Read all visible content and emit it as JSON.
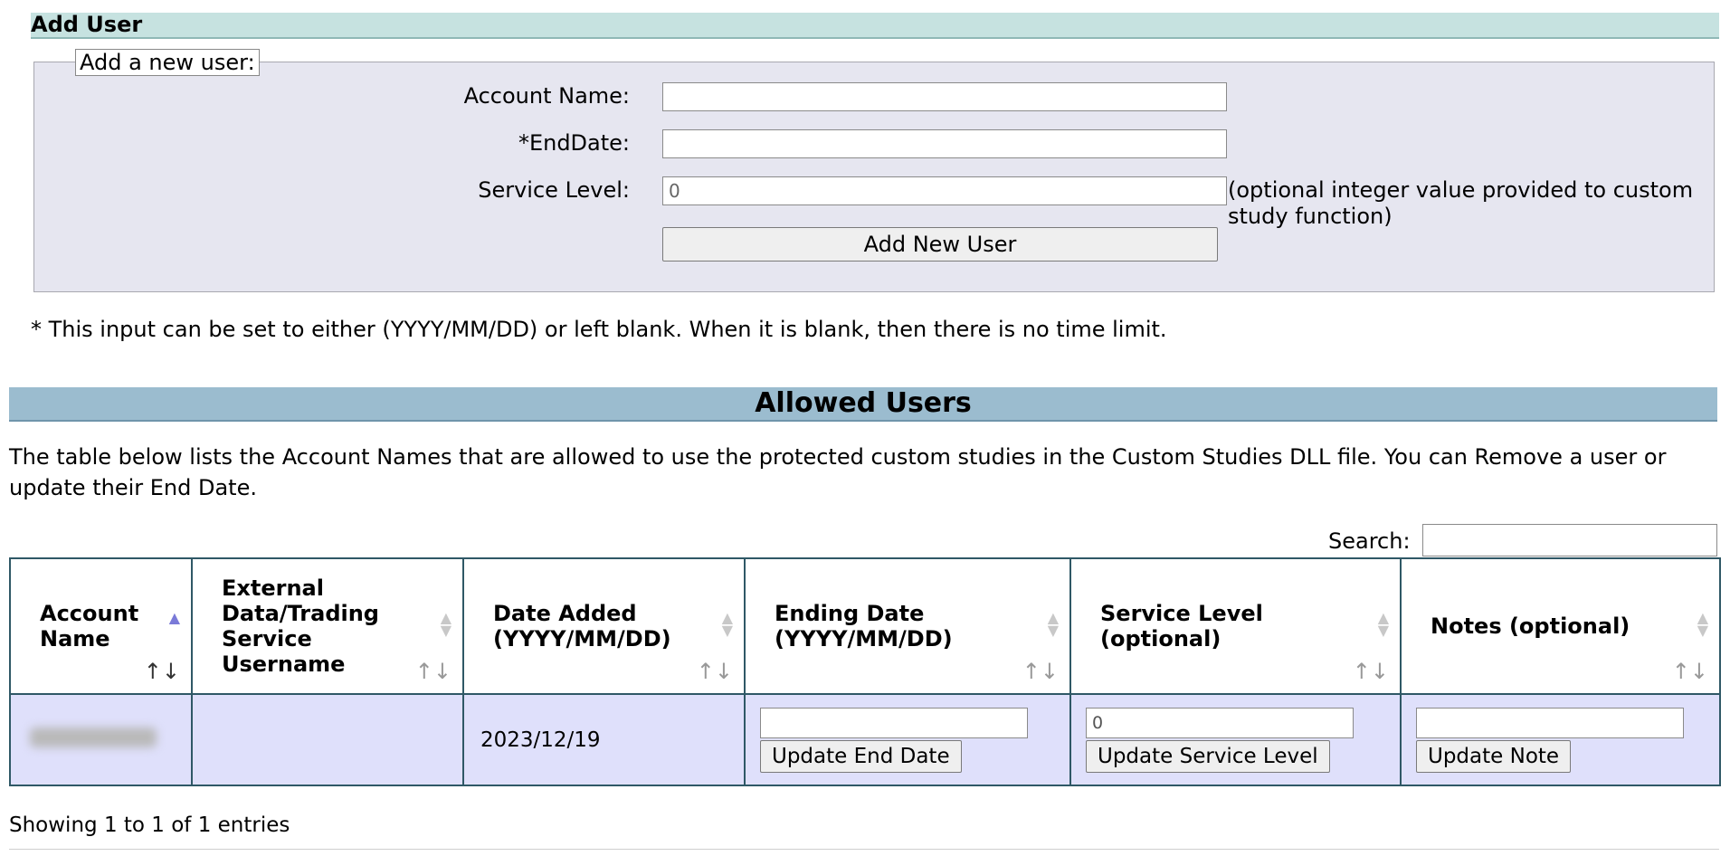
{
  "add_user": {
    "title": "Add User",
    "legend": "Add a new user:",
    "fields": {
      "account_name": {
        "label": "Account Name:",
        "value": ""
      },
      "end_date": {
        "label": "*EndDate:",
        "value": ""
      },
      "service_level": {
        "label": "Service Level:",
        "value": "0"
      }
    },
    "service_level_hint": "(optional integer value provided to custom study function)",
    "add_button": "Add New User",
    "footnote": "* This input can be set to either (YYYY/MM/DD) or left blank. When it is blank, then there is no time limit."
  },
  "allowed_users": {
    "title": "Allowed Users",
    "description": "The table below lists the Account Names that are allowed to use the protected custom studies in the Custom Studies DLL file. You can Remove a user or update their End Date.",
    "search_label": "Search:",
    "search_value": "",
    "columns": [
      "Account Name",
      "External Data/Trading Service Username",
      "Date Added (YYYY/MM/DD)",
      "Ending Date (YYYY/MM/DD)",
      "Service Level (optional)",
      "Notes (optional)"
    ],
    "sort_arrows": "↑↓",
    "rows": [
      {
        "external_username": "",
        "date_added": "2023/12/19",
        "end_date_value": "",
        "service_level_value": "0",
        "notes_value": "",
        "update_end_date_button": "Update End Date",
        "update_service_level_button": "Update Service Level",
        "update_note_button": "Update Note"
      }
    ],
    "showing": "Showing 1 to 1 of 1 entries"
  }
}
